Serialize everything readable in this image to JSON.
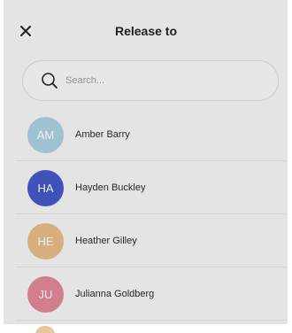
{
  "header": {
    "title": "Release to"
  },
  "search": {
    "placeholder": "Search..."
  },
  "contacts": [
    {
      "initials": "AM",
      "name": "Amber Barry",
      "color": "#a9cfe0"
    },
    {
      "initials": "HA",
      "name": "Hayden Buckley",
      "color": "#4457c6"
    },
    {
      "initials": "HE",
      "name": "Heather Gilley",
      "color": "#e5b985"
    },
    {
      "initials": "JU",
      "name": "Julianna Goldberg",
      "color": "#e08696"
    }
  ],
  "icons": {
    "close": "close-icon",
    "search": "search-icon"
  }
}
